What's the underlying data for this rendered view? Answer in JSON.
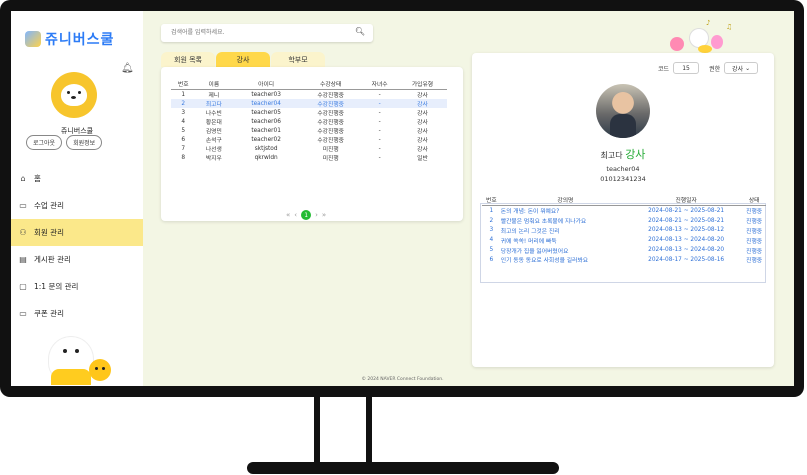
{
  "app": {
    "logo_text": "쥬니버스쿨",
    "footer": "© 2024 NAVER Connect Foundation."
  },
  "sidebar": {
    "username": "쥬니버스쿨",
    "logout_label": "로그아웃",
    "profile_label": "회원정보",
    "menu": [
      {
        "label": "홈",
        "icon": "home-icon"
      },
      {
        "label": "수업 관리",
        "icon": "monitor-icon"
      },
      {
        "label": "회원 관리",
        "icon": "users-icon",
        "active": true
      },
      {
        "label": "게시판 관리",
        "icon": "board-icon"
      },
      {
        "label": "1:1 문의 관리",
        "icon": "chat-icon"
      },
      {
        "label": "쿠폰 관리",
        "icon": "coupon-icon"
      }
    ]
  },
  "search": {
    "placeholder": "검색어를 입력하세요."
  },
  "tabs": [
    {
      "label": "회원 목록"
    },
    {
      "label": "강사",
      "active": true
    },
    {
      "label": "학부모"
    }
  ],
  "members": {
    "headers": [
      "번호",
      "이름",
      "아이디",
      "수강상태",
      "자녀수",
      "가입유형"
    ],
    "rows": [
      [
        "1",
        "제니",
        "teacher03",
        "수강진행중",
        "-",
        "강사"
      ],
      [
        "2",
        "최고다",
        "teacher04",
        "수강진행중",
        "-",
        "강사"
      ],
      [
        "3",
        "나수빈",
        "teacher05",
        "수강진행중",
        "-",
        "강사"
      ],
      [
        "4",
        "황은대",
        "teacher06",
        "수강진행중",
        "-",
        "강사"
      ],
      [
        "5",
        "김영민",
        "teacher01",
        "수강진행중",
        "-",
        "강사"
      ],
      [
        "6",
        "손석구",
        "teacher02",
        "수강진행중",
        "-",
        "강사"
      ],
      [
        "7",
        "나선생",
        "sktjstod",
        "미진행",
        "-",
        "강사"
      ],
      [
        "8",
        "박지우",
        "qkrwldn",
        "미진행",
        "-",
        "일반"
      ]
    ],
    "selected_row": 1,
    "pagination": {
      "first": "«",
      "prev": "‹",
      "current": "1",
      "next": "›",
      "last": "»"
    }
  },
  "detail": {
    "code_label": "코드",
    "code_value": "15",
    "role_label": "권한",
    "role_value": "강사",
    "name": "최고다",
    "role": "강사",
    "user_id": "teacher04",
    "phone": "01012341234",
    "courses": {
      "headers": [
        "번호",
        "강의명",
        "진행일자",
        "상태"
      ],
      "rows": [
        [
          "1",
          "돈의 개념: 돈이 뭐예요?",
          "2024-08-21 ~ 2025-08-21",
          "진행중"
        ],
        [
          "2",
          "빨간불은 멈춰요 초록불에 지나가요",
          "2024-08-21 ~ 2025-08-21",
          "진행중"
        ],
        [
          "3",
          "최고의 논리 그것은 진리",
          "2024-08-13 ~ 2025-08-12",
          "진행중"
        ],
        [
          "4",
          "귀에 쏙쏙! 머리에 빠둑",
          "2024-08-13 ~ 2024-08-20",
          "진행중"
        ],
        [
          "5",
          "당장개가 집을 잃어버렸어요",
          "2024-08-13 ~ 2024-08-20",
          "진행중"
        ],
        [
          "6",
          "인기 동동 동요로 사회성을 길러봐요",
          "2024-08-17 ~ 2025-08-16",
          "진행중"
        ]
      ]
    }
  },
  "colors": {
    "accent_yellow": "#ffd84a",
    "active_menu": "#fbe88a",
    "link_blue": "#2d6fd6",
    "role_green": "#22aa33",
    "page_green": "#22bb33"
  }
}
